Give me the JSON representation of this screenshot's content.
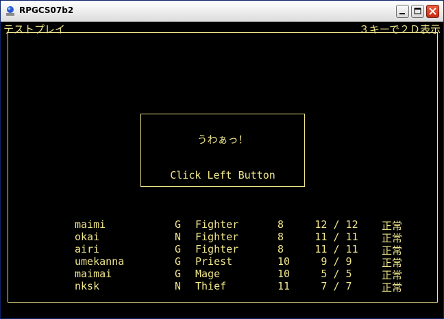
{
  "window": {
    "title": "RPGCS07b2"
  },
  "header": {
    "left_text": "テストプレイ",
    "right_text": "３キーで２Ｄ表示"
  },
  "message": {
    "line1": "うわぁっ！",
    "line2": "Click Left Button"
  },
  "party": [
    {
      "name": "maimi",
      "align": "G",
      "class": "Fighter",
      "level": "8",
      "hp": "12 / 12",
      "status": "正常"
    },
    {
      "name": "okai",
      "align": "N",
      "class": "Fighter",
      "level": "8",
      "hp": "11 / 11",
      "status": "正常"
    },
    {
      "name": "airi",
      "align": "G",
      "class": "Fighter",
      "level": "8",
      "hp": "11 / 11",
      "status": "正常"
    },
    {
      "name": "umekanna",
      "align": "G",
      "class": "Priest",
      "level": "10",
      "hp": "9 / 9",
      "status": "正常"
    },
    {
      "name": "maimai",
      "align": "G",
      "class": "Mage",
      "level": "10",
      "hp": "5 / 5",
      "status": "正常"
    },
    {
      "name": "nksk",
      "align": "N",
      "class": "Thief",
      "level": "11",
      "hp": "7 / 7",
      "status": "正常"
    }
  ],
  "colors": {
    "text": "#f0e68c",
    "background": "#000000"
  }
}
